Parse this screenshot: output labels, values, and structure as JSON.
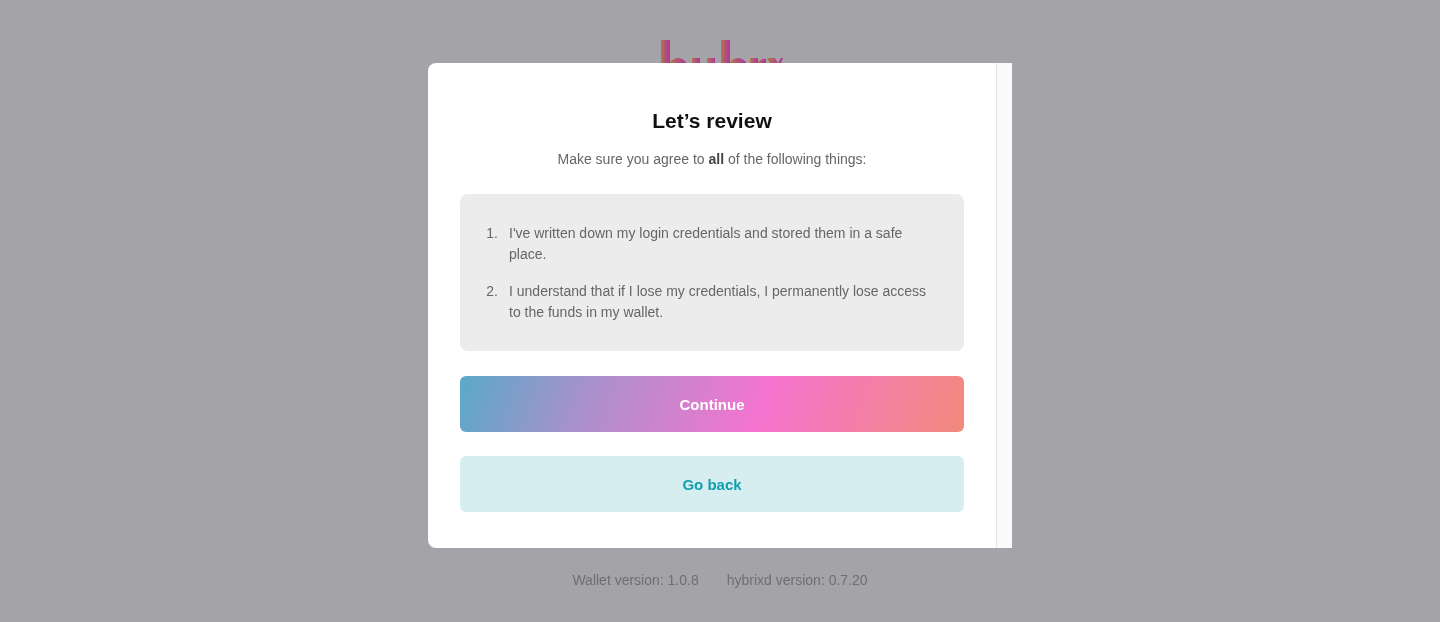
{
  "dialog": {
    "title": "Let’s review",
    "subtitle": "Make sure you agree to **all** of the following things:",
    "items": [
      {
        "number": "1.",
        "text": "I've written down my login credentials and stored them in a safe place."
      },
      {
        "number": "2.",
        "text": "I understand that if I lose my credentials, I permanently lose access to the funds in my wallet."
      }
    ],
    "buttons": [
      {
        "label": "Continue",
        "kind": "primary"
      },
      {
        "label": "Go back",
        "kind": "secondary"
      }
    ]
  },
  "footer": [
    "Wallet version: 1.0.8",
    "hybrixd version: 0.7.20"
  ]
}
